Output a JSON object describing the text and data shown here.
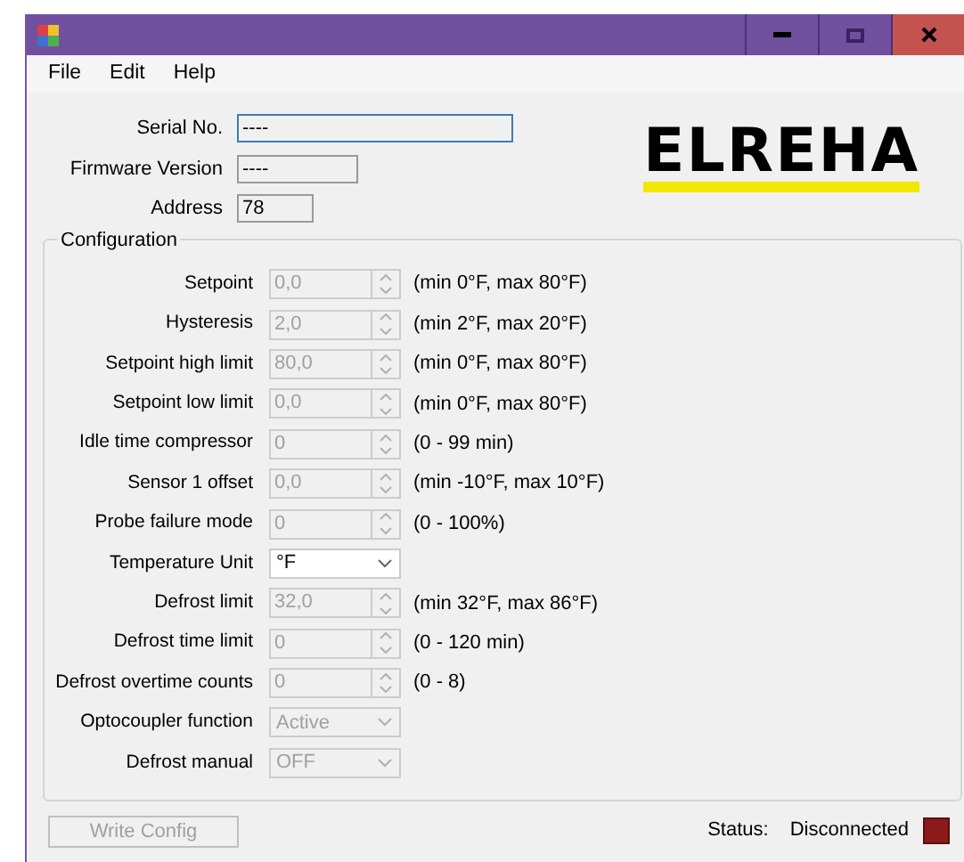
{
  "menu": [
    "File",
    "Edit",
    "Help"
  ],
  "info": [
    {
      "label": "Serial No.",
      "value": "----",
      "focused": true
    },
    {
      "label": "Firmware Version",
      "value": "----",
      "focused": false
    },
    {
      "label": "Address",
      "value": "78",
      "focused": false
    }
  ],
  "logo": "ELREHA",
  "configuration": {
    "title": "Configuration",
    "rows": [
      {
        "kind": "spinner",
        "label": "Setpoint",
        "value": "0,0",
        "hint": "(min 0°F, max 80°F)",
        "disabled": true
      },
      {
        "kind": "spinner",
        "label": "Hysteresis",
        "value": "2,0",
        "hint": "(min 2°F, max 20°F)",
        "disabled": true
      },
      {
        "kind": "spinner",
        "label": "Setpoint high limit",
        "value": "80,0",
        "hint": "(min 0°F, max 80°F)",
        "disabled": true
      },
      {
        "kind": "spinner",
        "label": "Setpoint low limit",
        "value": "0,0",
        "hint": "(min 0°F, max 80°F)",
        "disabled": true
      },
      {
        "kind": "spinner",
        "label": "Idle time compressor",
        "value": "0",
        "hint": "(0 - 99 min)",
        "disabled": true
      },
      {
        "kind": "spinner",
        "label": "Sensor 1 offset",
        "value": "0,0",
        "hint": "(min -10°F, max 10°F)",
        "disabled": true
      },
      {
        "kind": "spinner",
        "label": "Probe failure mode",
        "value": "0",
        "hint": "(0 - 100%)",
        "disabled": true
      },
      {
        "kind": "select",
        "label": "Temperature Unit",
        "value": "°F",
        "disabled": false
      },
      {
        "kind": "spinner",
        "label": "Defrost limit",
        "value": "32,0",
        "hint": "(min 32°F, max 86°F)",
        "disabled": true
      },
      {
        "kind": "spinner",
        "label": "Defrost time limit",
        "value": "0",
        "hint": "(0 - 120 min)",
        "disabled": true
      },
      {
        "kind": "spinner",
        "label": "Defrost overtime counts",
        "value": "0",
        "hint": "(0 - 8)",
        "disabled": true
      },
      {
        "kind": "select",
        "label": "Optocoupler function",
        "value": "Active",
        "disabled": true
      },
      {
        "kind": "select",
        "label": "Defrost manual",
        "value": "OFF",
        "disabled": true
      }
    ]
  },
  "write_button": {
    "label": "Write Config",
    "disabled": true
  },
  "status": {
    "label": "Status:",
    "value": "Disconnected",
    "color": "#8b1a1a"
  }
}
